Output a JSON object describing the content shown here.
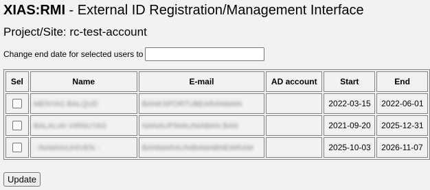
{
  "header": {
    "app_short": "XIAS:RMI",
    "app_sep": " - ",
    "app_long": "External ID Registration/Management Interface"
  },
  "project": {
    "label": "Project/Site:",
    "value": "rc-test-account"
  },
  "change_end": {
    "label": "Change end date for selected users to",
    "value": ""
  },
  "table": {
    "headers": [
      "Sel",
      "Name",
      "E-mail",
      "AD account",
      "Start",
      "End"
    ],
    "rows": [
      {
        "selected": false,
        "name": "MENYAS BALQUD",
        "email": "BANKSPORTUBEARANMAN",
        "ad_account": "",
        "start": "2022-03-15",
        "end": "2022-06-01"
      },
      {
        "selected": false,
        "name": "BALALIAI VIRNUYAS",
        "email": "NANAUPIMAUNIABAN BAN",
        "ad_account": "",
        "start": "2021-09-20",
        "end": "2025-12-31"
      },
      {
        "selected": false,
        "name": "- INAMIAIUHIVEN -",
        "email": "BANMARAUNIBAMABNEWRAM",
        "ad_account": "",
        "start": "2025-10-03",
        "end": "2026-11-07"
      }
    ]
  },
  "actions": {
    "update_label": "Update"
  }
}
